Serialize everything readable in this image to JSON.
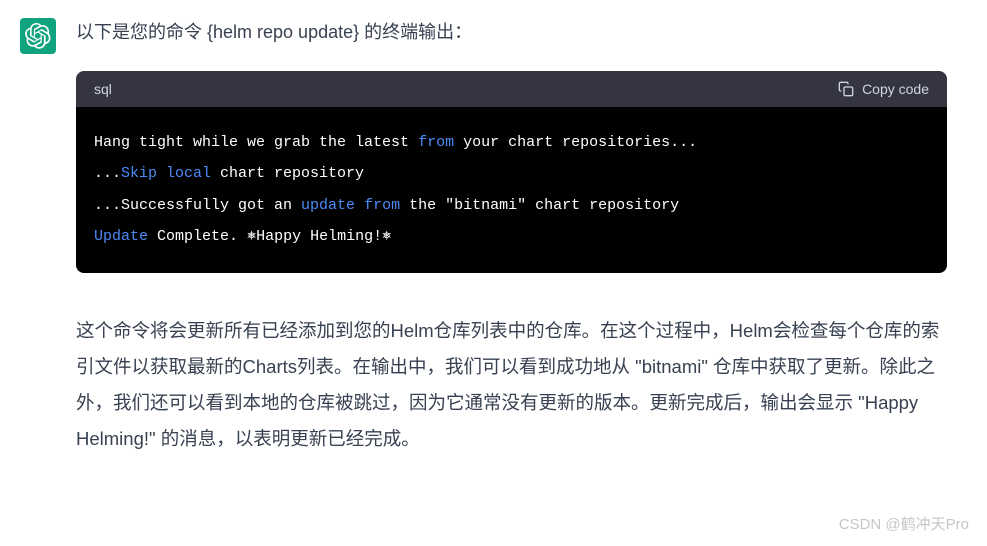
{
  "intro": "以下是您的命令 {helm repo update} 的终端输出：",
  "code": {
    "lang": "sql",
    "copy_label": "Copy code",
    "line1_pre": "Hang tight while we grab the latest ",
    "line1_kw": "from",
    "line1_post": " your chart repositories...",
    "line2_pre": "...",
    "line2_kw": "Skip local",
    "line2_post": " chart repository",
    "line3_pre": "...Successfully got an ",
    "line3_kw1": "update",
    "line3_mid": " ",
    "line3_kw2": "from",
    "line3_post": " the \"bitnami\" chart repository",
    "line4_kw": "Update",
    "line4_post": " Complete. ⎈Happy Helming!⎈"
  },
  "explanation": "这个命令将会更新所有已经添加到您的Helm仓库列表中的仓库。在这个过程中，Helm会检查每个仓库的索引文件以获取最新的Charts列表。在输出中，我们可以看到成功地从 \"bitnami\" 仓库中获取了更新。除此之外，我们还可以看到本地的仓库被跳过，因为它通常没有更新的版本。更新完成后，输出会显示 \"Happy Helming!\" 的消息，以表明更新已经完成。",
  "watermark": "CSDN @鹤冲天Pro"
}
